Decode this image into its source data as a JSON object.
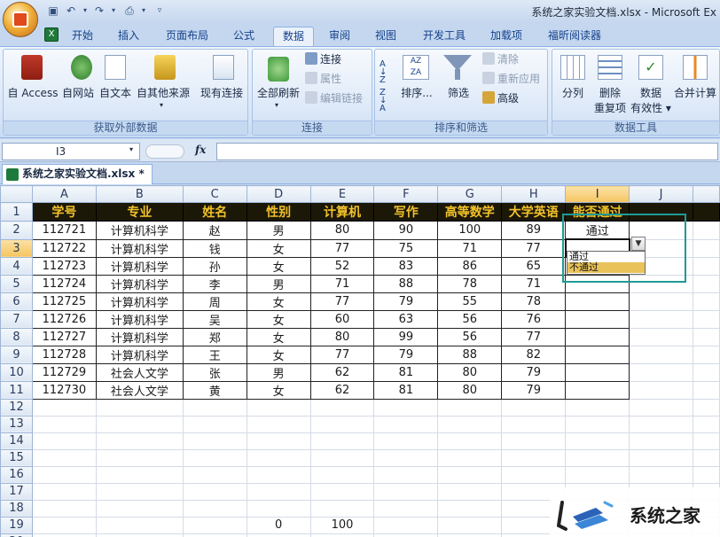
{
  "window": {
    "title": "系统之家实验文档.xlsx - Microsoft Ex"
  },
  "tabs": [
    "开始",
    "插入",
    "页面布局",
    "公式",
    "数据",
    "审阅",
    "视图",
    "开发工具",
    "加载项",
    "福昕阅读器"
  ],
  "active_tab": "数据",
  "ribbon": {
    "external": {
      "access": "自 Access",
      "web": "自网站",
      "text": "自文本",
      "other": "自其他来源",
      "existing": "现有连接",
      "label": "获取外部数据"
    },
    "connections": {
      "refresh_all": "全部刷新",
      "connections": "连接",
      "properties": "属性",
      "edit_links": "编辑链接",
      "label": "连接"
    },
    "sort_filter": {
      "az": "A↓Z",
      "za": "Z↓A",
      "sort": "排序...",
      "filter": "筛选",
      "clear": "清除",
      "reapply": "重新应用",
      "advanced": "高级",
      "label": "排序和筛选"
    },
    "data_tools": {
      "split": "分列",
      "remove_dup_1": "删除",
      "remove_dup_2": "重复项",
      "validation_1": "数据",
      "validation_2": "有效性",
      "consolidate": "合并计算",
      "label": "数据工具"
    }
  },
  "formula_bar": {
    "name_box": "I3",
    "fx": "fx",
    "value": ""
  },
  "doc_tab": "系统之家实验文档.xlsx *",
  "columns": [
    "A",
    "B",
    "C",
    "D",
    "E",
    "F",
    "G",
    "H",
    "I",
    "J"
  ],
  "rows": [
    [
      "学号",
      "专业",
      "姓名",
      "性别",
      "计算机",
      "写作",
      "高等数学",
      "大学英语",
      "能否通过",
      ""
    ],
    [
      "112721",
      "计算机科学",
      "赵",
      "男",
      "80",
      "90",
      "100",
      "89",
      "通过",
      ""
    ],
    [
      "112722",
      "计算机科学",
      "钱",
      "女",
      "77",
      "75",
      "71",
      "77",
      "",
      ""
    ],
    [
      "112723",
      "计算机科学",
      "孙",
      "女",
      "52",
      "83",
      "86",
      "65",
      "",
      ""
    ],
    [
      "112724",
      "计算机科学",
      "李",
      "男",
      "71",
      "88",
      "78",
      "71",
      "",
      ""
    ],
    [
      "112725",
      "计算机科学",
      "周",
      "女",
      "77",
      "79",
      "55",
      "78",
      "",
      ""
    ],
    [
      "112726",
      "计算机科学",
      "吴",
      "女",
      "60",
      "63",
      "56",
      "76",
      "",
      ""
    ],
    [
      "112727",
      "计算机科学",
      "郑",
      "女",
      "80",
      "99",
      "56",
      "77",
      "",
      ""
    ],
    [
      "112728",
      "计算机科学",
      "王",
      "女",
      "77",
      "79",
      "88",
      "82",
      "",
      ""
    ],
    [
      "112729",
      "社会人文学",
      "张",
      "男",
      "62",
      "81",
      "80",
      "79",
      "",
      ""
    ],
    [
      "112730",
      "社会人文学",
      "黄",
      "女",
      "62",
      "81",
      "80",
      "79",
      "",
      ""
    ],
    [
      "",
      "",
      "",
      "",
      "",
      "",
      "",
      "",
      "",
      ""
    ],
    [
      "",
      "",
      "",
      "",
      "",
      "",
      "",
      "",
      "",
      ""
    ],
    [
      "",
      "",
      "",
      "",
      "",
      "",
      "",
      "",
      "",
      ""
    ],
    [
      "",
      "",
      "",
      "",
      "",
      "",
      "",
      "",
      "",
      ""
    ],
    [
      "",
      "",
      "",
      "",
      "",
      "",
      "",
      "",
      "",
      ""
    ],
    [
      "",
      "",
      "",
      "",
      "",
      "",
      "",
      "",
      "",
      ""
    ],
    [
      "",
      "",
      "",
      "",
      "",
      "",
      "",
      "",
      "",
      ""
    ],
    [
      "",
      "",
      "",
      "0",
      "100",
      "",
      "",
      "",
      "",
      ""
    ],
    [
      "",
      "",
      "",
      "",
      "",
      "",
      "",
      "",
      "",
      ""
    ]
  ],
  "dropdown": {
    "options": [
      "通过",
      "不通过"
    ],
    "highlighted": "不通过"
  },
  "colors": {
    "header_bg": "#1c1808",
    "header_text": "#f3c22a",
    "highlight_box": "#1f9a94",
    "dropdown_highlight": "#e9c25a"
  },
  "watermark": {
    "text": "系统之家"
  }
}
